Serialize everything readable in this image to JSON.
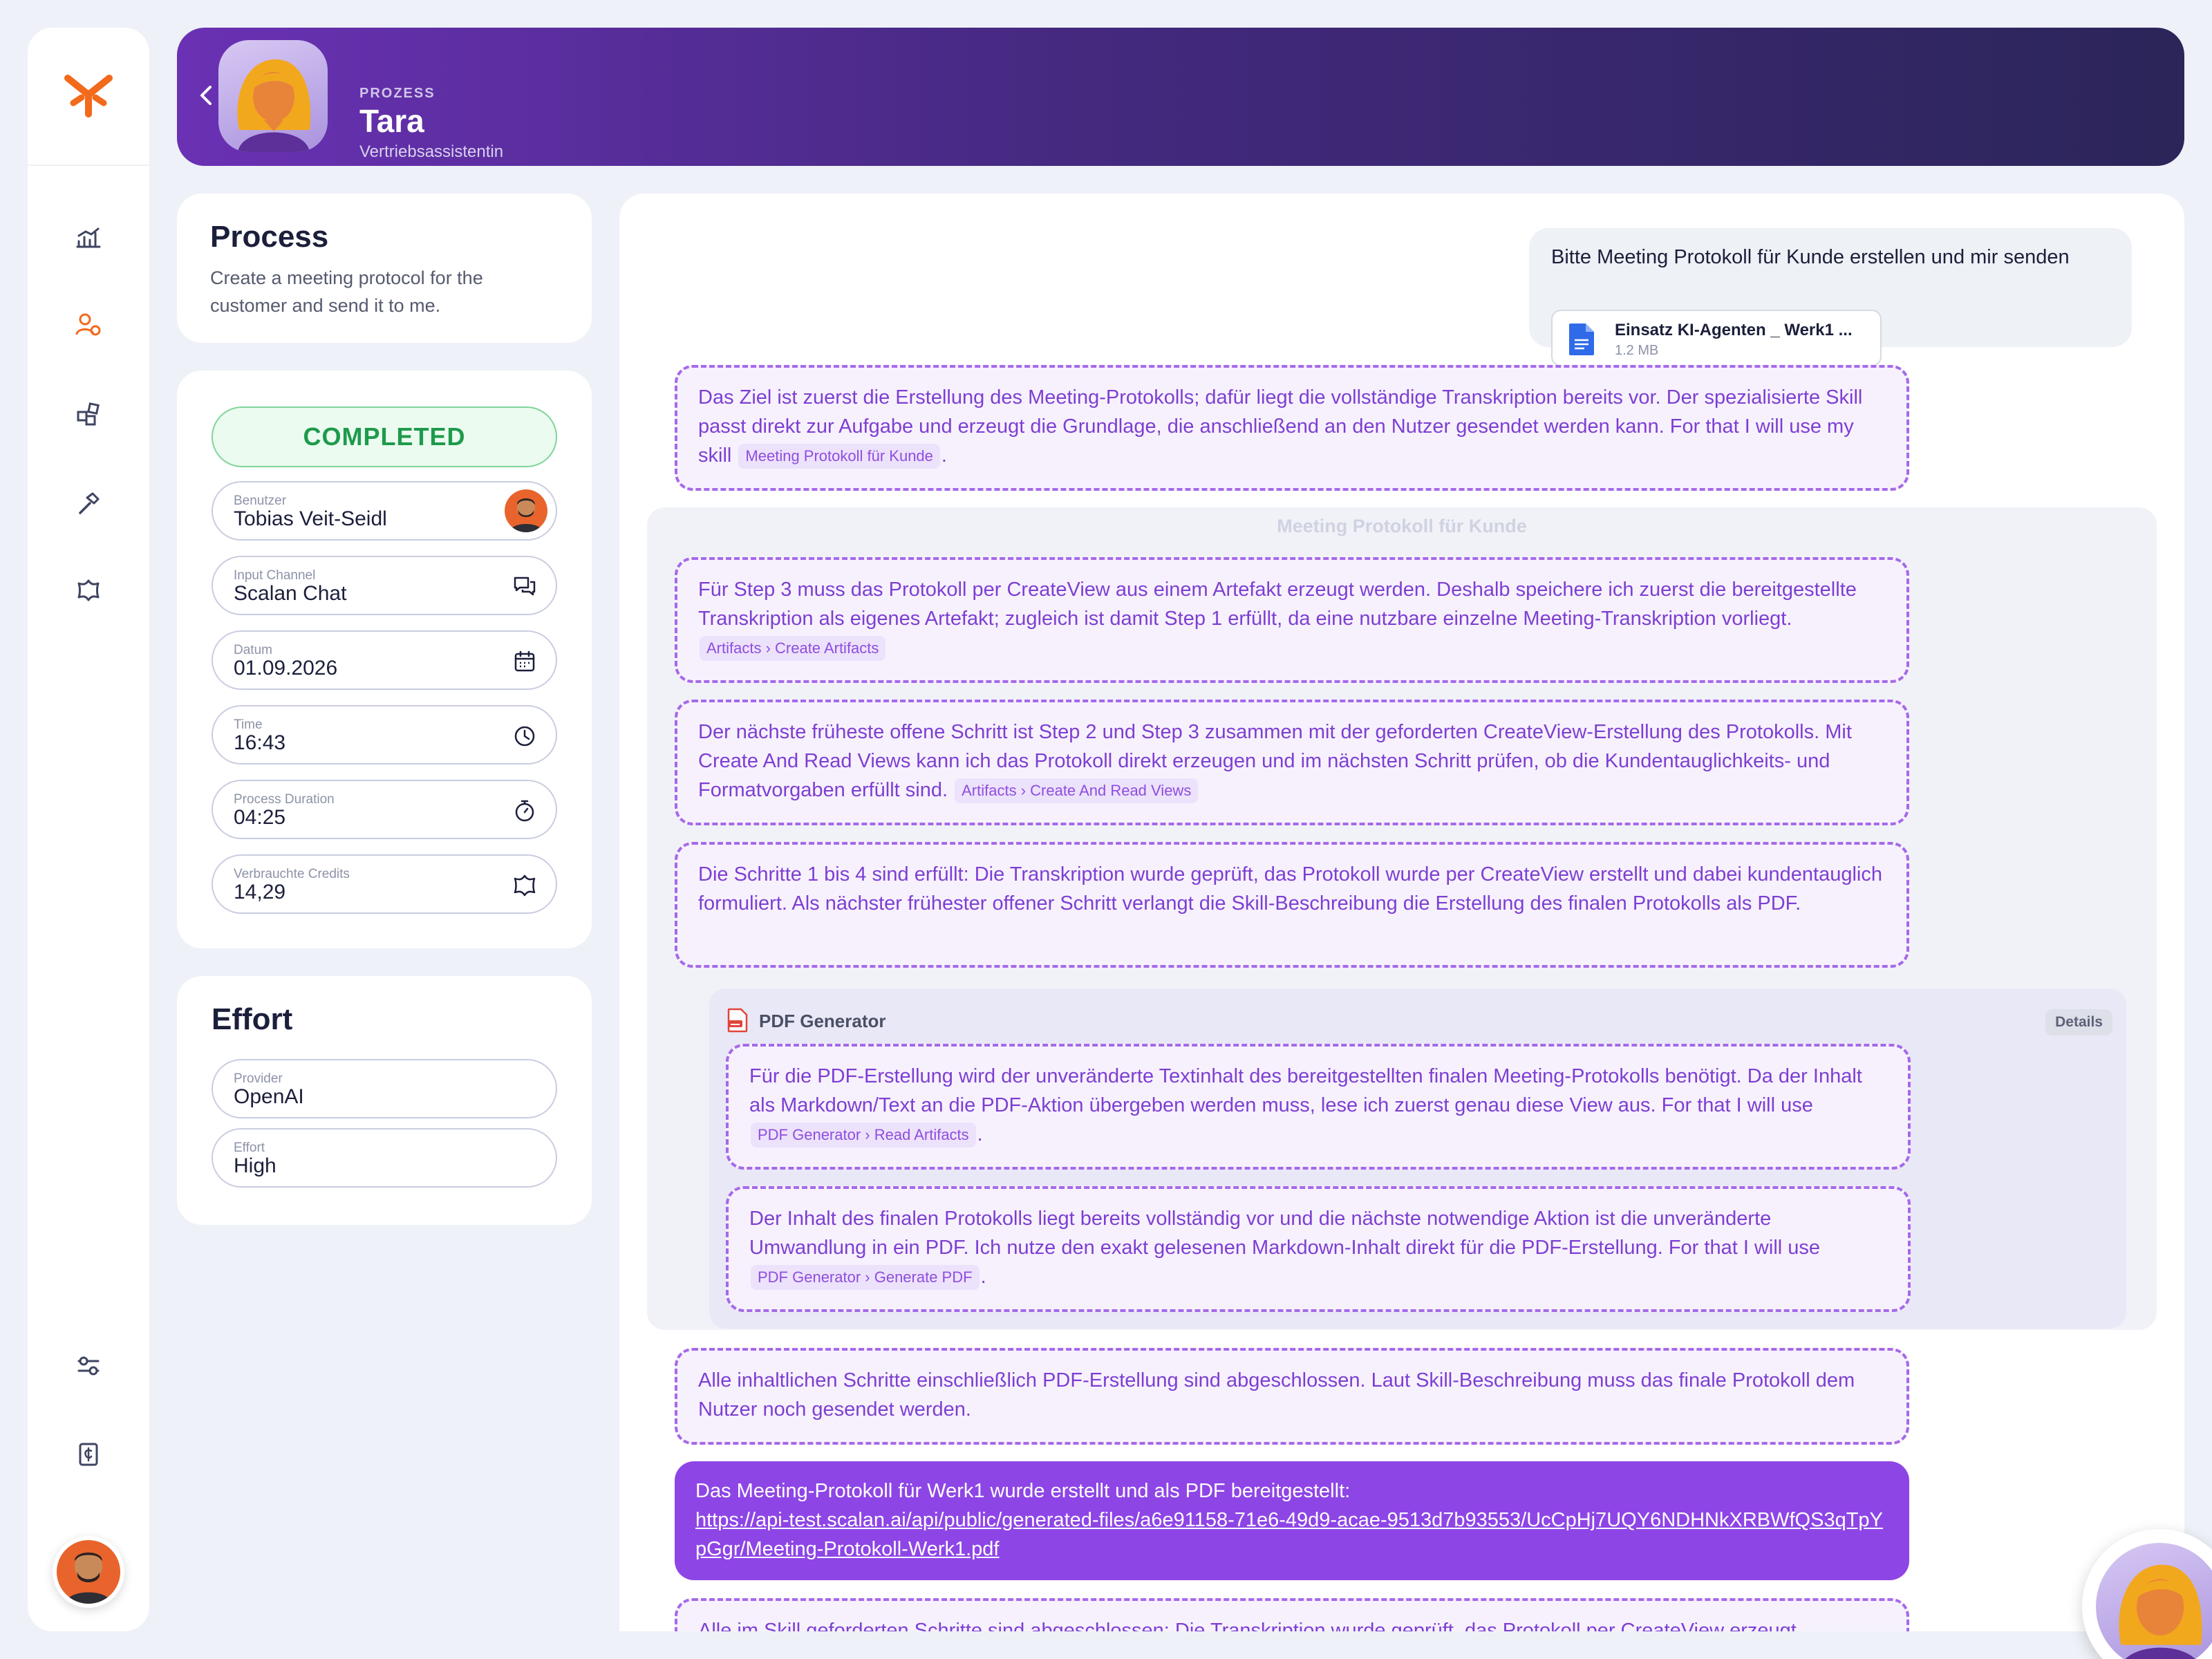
{
  "header": {
    "kicker": "PROZESS",
    "name": "Tara",
    "role": "Vertriebsassistentin"
  },
  "process": {
    "title": "Process",
    "description": "Create a meeting protocol for the customer and send it to me."
  },
  "status": {
    "label": "COMPLETED",
    "fields": [
      {
        "label": "Benutzer",
        "value": "Tobias Veit-Seidl"
      },
      {
        "label": "Input Channel",
        "value": "Scalan Chat"
      },
      {
        "label": "Datum",
        "value": "01.09.2026"
      },
      {
        "label": "Time",
        "value": "16:43"
      },
      {
        "label": "Process Duration",
        "value": "04:25"
      },
      {
        "label": "Verbrauchte Credits",
        "value": "14,29"
      }
    ]
  },
  "effort": {
    "title": "Effort",
    "fields": [
      {
        "label": "Provider",
        "value": "OpenAI"
      },
      {
        "label": "Effort",
        "value": "High"
      }
    ]
  },
  "chat": {
    "user_message": "Bitte Meeting Protokoll für Kunde erstellen und mir senden",
    "attachment": {
      "name": "Einsatz KI-Agenten _ Werk1 ...",
      "size": "1.2 MB"
    },
    "thought1": {
      "text": "Das Ziel ist zuerst die Erstellung des Meeting-Protokolls; dafür liegt die vollständige Transkription bereits vor. Der spezialisierte Skill passt direkt zur Aufgabe und erzeugt die Grundlage, die anschließend an den Nutzer gesendet werden kann. For that I will use my skill",
      "tag": "Meeting Protokoll für Kunde",
      "end": "."
    },
    "skill_title": "Meeting Protokoll für Kunde",
    "thought2": {
      "text": "Für Step 3 muss das Protokoll per CreateView aus einem Artefakt erzeugt werden. Deshalb speichere ich zuerst die bereitgestellte Transkription als eigenes Artefakt; zugleich ist damit Step 1 erfüllt, da eine nutzbare einzelne Meeting-Transkription vorliegt.",
      "tag": "Artifacts › Create Artifacts"
    },
    "thought3": {
      "text": "Der nächste früheste offene Schritt ist Step 2 und Step 3 zusammen mit der geforderten CreateView-Erstellung des Protokolls. Mit Create And Read Views kann ich das Protokoll direkt erzeugen und im nächsten Schritt prüfen, ob die Kundentauglichkeits- und Formatvorgaben erfüllt sind.",
      "tag": "Artifacts › Create And Read Views"
    },
    "thought4": {
      "text": "Die Schritte 1 bis 4 sind erfüllt: Die Transkription wurde geprüft, das Protokoll wurde per CreateView erstellt und dabei kundentauglich formuliert. Als nächster frühester offener Schritt verlangt die Skill-Beschreibung die Erstellung des finalen Protokolls als PDF."
    },
    "pdf": {
      "title": "PDF Generator",
      "details": "Details",
      "thought1": {
        "text": "Für die PDF-Erstellung wird der unveränderte Textinhalt des bereitgestellten finalen Meeting-Protokolls benötigt. Da der Inhalt als Markdown/Text an die PDF-Aktion übergeben werden muss, lese ich zuerst genau diese View aus. For that I will use",
        "tag": "PDF Generator › Read Artifacts",
        "end": "."
      },
      "thought2": {
        "text": "Der Inhalt des finalen Protokolls liegt bereits vollständig vor und die nächste notwendige Aktion ist die unveränderte Umwandlung in ein PDF. Ich nutze den exakt gelesenen Markdown-Inhalt direkt für die PDF-Erstellung. For that I will use",
        "tag": "PDF Generator › Generate PDF",
        "end": "."
      }
    },
    "thought5": {
      "text": "Alle inhaltlichen Schritte einschließlich PDF-Erstellung sind abgeschlossen. Laut Skill-Beschreibung muss das finale Protokoll dem Nutzer noch gesendet werden."
    },
    "final": {
      "text": "Das Meeting-Protokoll für Werk1 wurde erstellt und als PDF bereitgestellt:",
      "link": "https://api-test.scalan.ai/api/public/generated-files/a6e91158-71e6-49d9-acae-9513d7b93553/UcCpHj7UQY6NDHNkXRBWfQS3qTpYpGgr/Meeting-Protokoll-Werk1.pdf"
    },
    "thought6": {
      "text": "Alle im Skill geforderten Schritte sind abgeschlossen: Die Transkription wurde geprüft, das Protokoll per CreateView erzeugt"
    }
  },
  "colors": {
    "brand_orange": "#f26a1b",
    "purple": "#8e45e6",
    "green": "#1e9a4b"
  }
}
